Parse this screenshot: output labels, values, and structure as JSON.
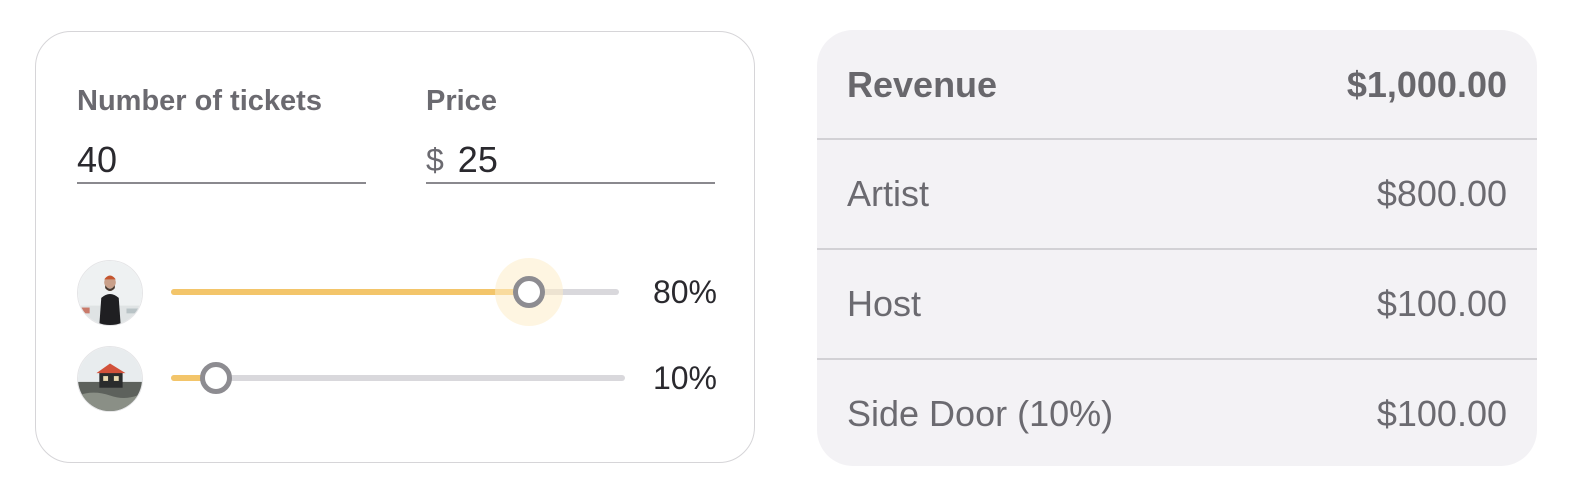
{
  "calculator": {
    "tickets": {
      "label": "Number of tickets",
      "value": "40"
    },
    "price": {
      "label": "Price",
      "currency_symbol": "$",
      "value": "25"
    },
    "splits": [
      {
        "avatar_icon": "person-avatar",
        "percent_label": "80%",
        "value": 0.8
      },
      {
        "avatar_icon": "house-avatar",
        "percent_label": "10%",
        "value": 0.1
      }
    ]
  },
  "summary": {
    "rows": [
      {
        "label": "Revenue",
        "amount": "$1,000.00"
      },
      {
        "label": "Artist",
        "amount": "$800.00"
      },
      {
        "label": "Host",
        "amount": "$100.00"
      },
      {
        "label": "Side Door (10%)",
        "amount": "$100.00"
      }
    ]
  },
  "colors": {
    "slider_fill": "#f3c56a",
    "slider_thumb_border": "#8d8c91",
    "summary_background": "#f3f2f5"
  }
}
